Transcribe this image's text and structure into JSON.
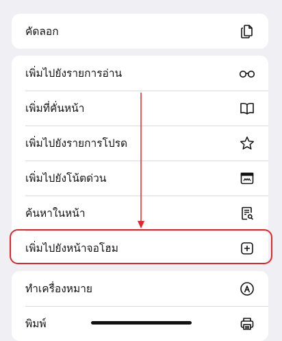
{
  "menu": {
    "copy": {
      "label": "คัดลอก",
      "icon": "copy-document-icon"
    },
    "actions": [
      {
        "label": "เพิ่มไปยังรายการอ่าน",
        "icon": "reading-glasses-icon"
      },
      {
        "label": "เพิ่มที่คั่นหน้า",
        "icon": "book-icon"
      },
      {
        "label": "เพิ่มไปยังรายการโปรด",
        "icon": "star-icon"
      },
      {
        "label": "เพิ่มไปยังโน้ตด่วน",
        "icon": "quick-note-icon"
      },
      {
        "label": "ค้นหาในหน้า",
        "icon": "find-in-page-icon"
      },
      {
        "label": "เพิ่มไปยังหน้าจอโฮม",
        "icon": "add-square-icon"
      }
    ],
    "tools": [
      {
        "label": "ทำเครื่องหมาย",
        "icon": "markup-pen-icon"
      },
      {
        "label": "พิมพ์",
        "icon": "printer-icon"
      }
    ]
  },
  "annotation": {
    "highlight_color": "#e0262b"
  }
}
